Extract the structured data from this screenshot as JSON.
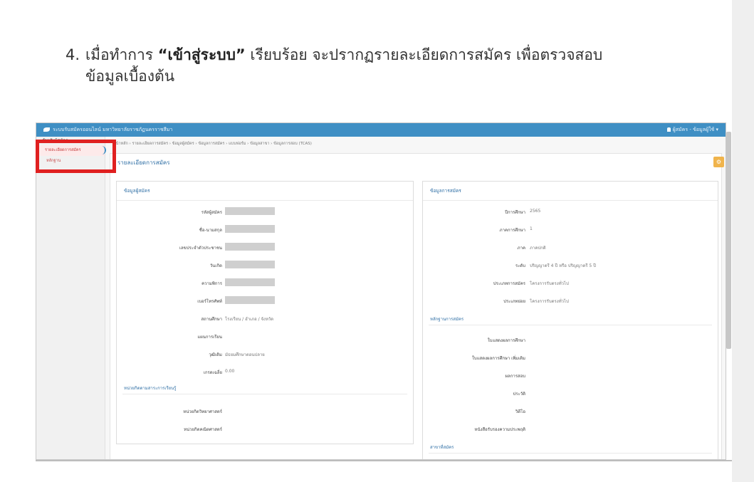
{
  "instruction": {
    "number": "4.",
    "part1": "เมื่อทำการ ",
    "quote": "“เข้าสู่ระบบ”",
    "part2": " เรียบร้อย จะปรากฏรายละเอียดการสมัคร เพื่อตรวจสอบ",
    "line2": "ข้อมูลเบื้องต้น"
  },
  "app": {
    "brand": "ระบบรับสมัครออนไลน์ มหาวิทยาลัยราชภัฏนครราชสีมา",
    "user": "ผู้สมัคร - ข้อมูลผู้ใช้"
  },
  "sidebar": {
    "heading": "สำหรับผู้สมัคร",
    "items": [
      {
        "label": "รายละเอียดการสมัคร"
      },
      {
        "label": "หลักฐาน"
      }
    ]
  },
  "breadcrumb": "หน้าหลัก › รายละเอียดการสมัคร › ข้อมูลผู้สมัคร › ข้อมูลการสมัคร › แบบฟอร์ม › ข้อมูลสาขา › ข้อมูลการสอบ (TCAS)",
  "main": {
    "title": "รายละเอียดการสมัคร",
    "gear_label": "⚙"
  },
  "applicant": {
    "heading": "ข้อมูลผู้สมัคร",
    "fields": [
      {
        "label": "รหัสผู้สมัคร",
        "value": ""
      },
      {
        "label": "ชื่อ-นามสกุล",
        "value": ""
      },
      {
        "label": "เลขประจำตัวประชาชน",
        "value": ""
      },
      {
        "label": "วันเกิด",
        "value": ""
      },
      {
        "label": "ความพิการ",
        "value": ""
      },
      {
        "label": "เบอร์โทรศัพท์",
        "value": ""
      },
      {
        "label": "สถานศึกษา",
        "value": "โรงเรียน / อำเภอ / จังหวัด"
      },
      {
        "label": "แผนการเรียน",
        "value": ""
      },
      {
        "label": "วุฒิเดิม",
        "value": "มัธยมศึกษาตอนปลาย"
      },
      {
        "label": "เกรดเฉลี่ย",
        "value": "0.00"
      }
    ],
    "contact_heading": "หน่วยกิตตามสาระการเรียนรู้",
    "contact_fields": [
      {
        "label": "หน่วยกิตวิทยาศาสตร์",
        "value": ""
      },
      {
        "label": "หน่วยกิตคณิตศาสตร์",
        "value": ""
      }
    ]
  },
  "application": {
    "heading": "ข้อมูลการสมัคร",
    "fields": [
      {
        "label": "ปีการศึกษา",
        "value": "2565"
      },
      {
        "label": "ภาคการศึกษา",
        "value": "1"
      },
      {
        "label": "ภาค",
        "value": "ภาคปกติ"
      },
      {
        "label": "ระดับ",
        "value": "ปริญญาตรี 4 ปี หรือ ปริญญาตรี 5 ปี"
      },
      {
        "label": "ประเภทการสมัคร",
        "value": "โครงการรับตรงทั่วไป"
      },
      {
        "label": "ประเภทย่อย",
        "value": "โครงการรับตรงทั่วไป"
      }
    ],
    "docs_heading": "หลักฐานการสมัคร",
    "docs": [
      {
        "label": "ใบแสดงผลการศึกษา"
      },
      {
        "label": "ใบแสดงผลการศึกษา เพิ่มเติม"
      },
      {
        "label": "ผลการสอบ"
      },
      {
        "label": "ประวัติ"
      },
      {
        "label": "วิดีโอ"
      },
      {
        "label": "หนังสือรับรองความประพฤติ"
      }
    ],
    "branch_heading": "สาขาที่สมัคร"
  }
}
